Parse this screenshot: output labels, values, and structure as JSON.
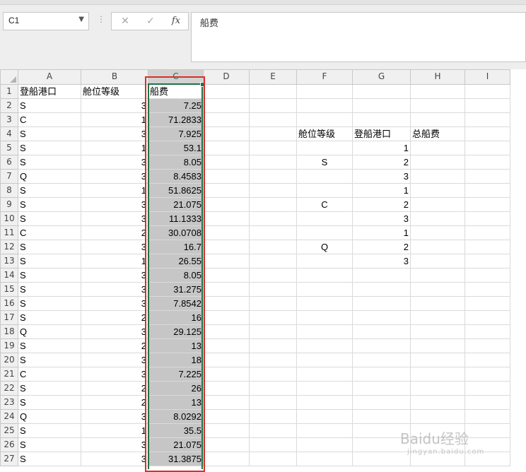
{
  "name_box": {
    "value": "C1"
  },
  "formula_bar": {
    "content": "船费"
  },
  "columns": [
    "A",
    "B",
    "C",
    "D",
    "E",
    "F",
    "G",
    "H",
    "I"
  ],
  "rows": [
    {
      "n": "1",
      "a": "登船港口",
      "b": "舱位等级",
      "c": "船费",
      "f": "",
      "g": "",
      "h": ""
    },
    {
      "n": "2",
      "a": "S",
      "b": "3",
      "c": "7.25",
      "f": "",
      "g": "",
      "h": ""
    },
    {
      "n": "3",
      "a": "C",
      "b": "1",
      "c": "71.2833",
      "f": "",
      "g": "",
      "h": ""
    },
    {
      "n": "4",
      "a": "S",
      "b": "3",
      "c": "7.925",
      "f": "舱位等级",
      "g": "登船港口",
      "h": "总船费"
    },
    {
      "n": "5",
      "a": "S",
      "b": "1",
      "c": "53.1",
      "f": "",
      "g": "1",
      "h": ""
    },
    {
      "n": "6",
      "a": "S",
      "b": "3",
      "c": "8.05",
      "f": "S",
      "g": "2",
      "h": ""
    },
    {
      "n": "7",
      "a": "Q",
      "b": "3",
      "c": "8.4583",
      "f": "",
      "g": "3",
      "h": ""
    },
    {
      "n": "8",
      "a": "S",
      "b": "1",
      "c": "51.8625",
      "f": "",
      "g": "1",
      "h": ""
    },
    {
      "n": "9",
      "a": "S",
      "b": "3",
      "c": "21.075",
      "f": "C",
      "g": "2",
      "h": ""
    },
    {
      "n": "10",
      "a": "S",
      "b": "3",
      "c": "11.1333",
      "f": "",
      "g": "3",
      "h": ""
    },
    {
      "n": "11",
      "a": "C",
      "b": "2",
      "c": "30.0708",
      "f": "",
      "g": "1",
      "h": ""
    },
    {
      "n": "12",
      "a": "S",
      "b": "3",
      "c": "16.7",
      "f": "Q",
      "g": "2",
      "h": ""
    },
    {
      "n": "13",
      "a": "S",
      "b": "1",
      "c": "26.55",
      "f": "",
      "g": "3",
      "h": ""
    },
    {
      "n": "14",
      "a": "S",
      "b": "3",
      "c": "8.05",
      "f": "",
      "g": "",
      "h": ""
    },
    {
      "n": "15",
      "a": "S",
      "b": "3",
      "c": "31.275",
      "f": "",
      "g": "",
      "h": ""
    },
    {
      "n": "16",
      "a": "S",
      "b": "3",
      "c": "7.8542",
      "f": "",
      "g": "",
      "h": ""
    },
    {
      "n": "17",
      "a": "S",
      "b": "2",
      "c": "16",
      "f": "",
      "g": "",
      "h": ""
    },
    {
      "n": "18",
      "a": "Q",
      "b": "3",
      "c": "29.125",
      "f": "",
      "g": "",
      "h": ""
    },
    {
      "n": "19",
      "a": "S",
      "b": "2",
      "c": "13",
      "f": "",
      "g": "",
      "h": ""
    },
    {
      "n": "20",
      "a": "S",
      "b": "3",
      "c": "18",
      "f": "",
      "g": "",
      "h": ""
    },
    {
      "n": "21",
      "a": "C",
      "b": "3",
      "c": "7.225",
      "f": "",
      "g": "",
      "h": ""
    },
    {
      "n": "22",
      "a": "S",
      "b": "2",
      "c": "26",
      "f": "",
      "g": "",
      "h": ""
    },
    {
      "n": "23",
      "a": "S",
      "b": "2",
      "c": "13",
      "f": "",
      "g": "",
      "h": ""
    },
    {
      "n": "24",
      "a": "Q",
      "b": "3",
      "c": "8.0292",
      "f": "",
      "g": "",
      "h": ""
    },
    {
      "n": "25",
      "a": "S",
      "b": "1",
      "c": "35.5",
      "f": "",
      "g": "",
      "h": ""
    },
    {
      "n": "26",
      "a": "S",
      "b": "3",
      "c": "21.075",
      "f": "",
      "g": "",
      "h": ""
    },
    {
      "n": "27",
      "a": "S",
      "b": "3",
      "c": "31.3875",
      "f": "",
      "g": "",
      "h": ""
    }
  ],
  "colors": {
    "selection_green": "#217346",
    "highlight_red": "#d9302a",
    "selected_fill": "#c6c6c6"
  },
  "watermark": {
    "text": "Baidu经验",
    "sub": "jingyan.baidu.com"
  }
}
